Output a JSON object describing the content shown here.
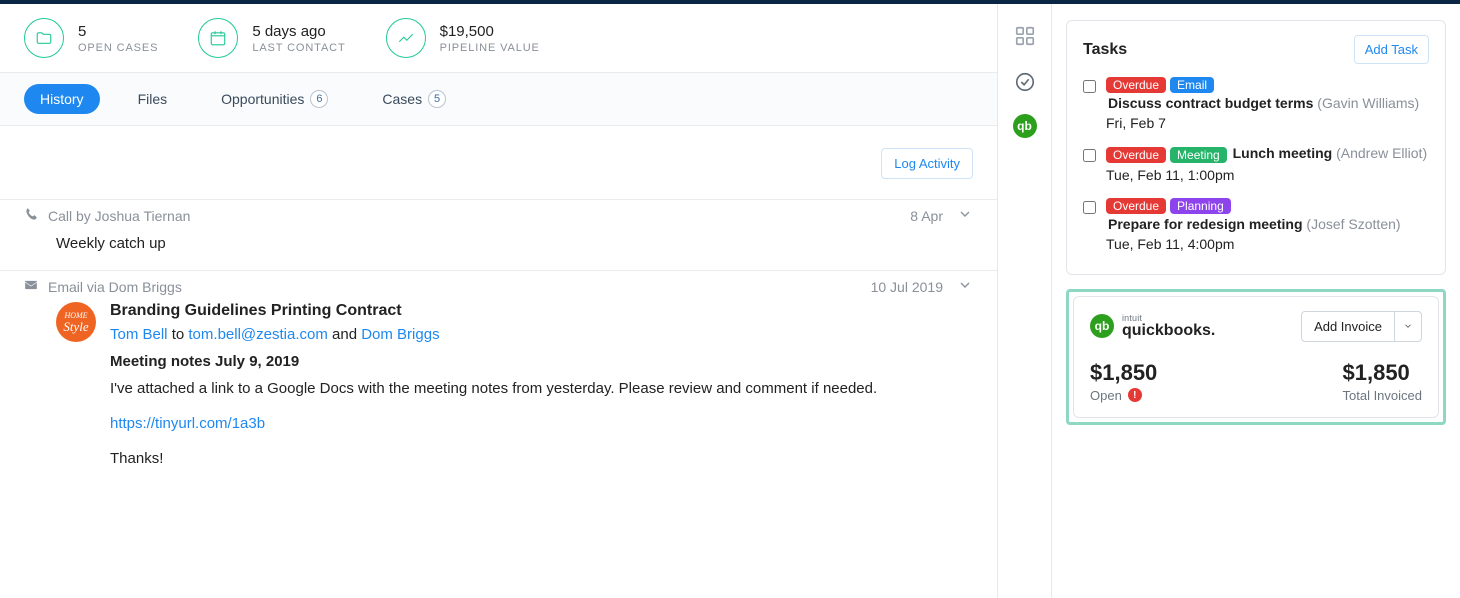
{
  "stats": {
    "open_cases": {
      "value": "5",
      "label": "OPEN CASES"
    },
    "last_contact": {
      "value": "5 days ago",
      "label": "LAST CONTACT"
    },
    "pipeline": {
      "value": "$19,500",
      "label": "PIPELINE VALUE"
    }
  },
  "tabs": {
    "history": "History",
    "files": "Files",
    "opportunities": {
      "label": "Opportunities",
      "count": "6"
    },
    "cases": {
      "label": "Cases",
      "count": "5"
    }
  },
  "log_activity": "Log Activity",
  "call": {
    "header": "Call by Joshua Tiernan",
    "date": "8 Apr",
    "body": "Weekly catch up"
  },
  "email": {
    "header": "Email via Dom Briggs",
    "date": "10 Jul 2019",
    "avatar_text": "Style",
    "subject": "Branding Guidelines Printing Contract",
    "from": "Tom Bell",
    "to_word": " to ",
    "to_email": "tom.bell@zestia.com",
    "and_word": " and ",
    "cc": "Dom Briggs",
    "notes_title": "Meeting notes July 9, 2019",
    "body": "I've attached a link to a Google Docs with the meeting notes from yesterday. Please review and comment if needed.",
    "link": "https://tinyurl.com/1a3b",
    "thanks": "Thanks!"
  },
  "tasks": {
    "title": "Tasks",
    "add": "Add Task",
    "items": [
      {
        "badges": {
          "overdue": "Overdue",
          "type": "Email",
          "type_class": "email"
        },
        "title": "Discuss contract budget terms",
        "assignee": "(Gavin Williams)",
        "when": "Fri, Feb 7"
      },
      {
        "badges": {
          "overdue": "Overdue",
          "type": "Meeting",
          "type_class": "meeting"
        },
        "title": "Lunch meeting",
        "assignee": "(Andrew Elliot)",
        "when": "Tue, Feb 11, 1:00pm"
      },
      {
        "badges": {
          "overdue": "Overdue",
          "type": "Planning",
          "type_class": "planning"
        },
        "title": "Prepare for redesign meeting",
        "assignee": "(Josef Szotten)",
        "when": "Tue, Feb 11, 4:00pm"
      }
    ]
  },
  "qb": {
    "intuit": "intuit",
    "name": "quickbooks.",
    "add_invoice": "Add Invoice",
    "open": {
      "value": "$1,850",
      "label": "Open"
    },
    "total": {
      "value": "$1,850",
      "label": "Total Invoiced"
    }
  }
}
